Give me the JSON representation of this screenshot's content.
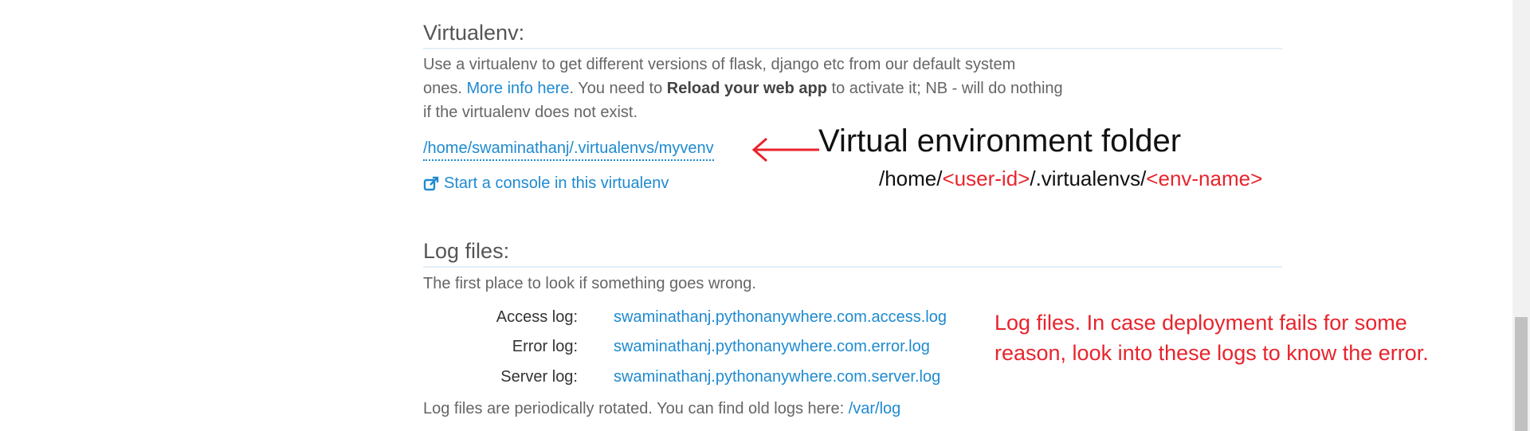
{
  "virtualenv": {
    "title": "Virtualenv:",
    "desc_part1": "Use a virtualenv to get different versions of flask, django etc from our default system",
    "desc_part2": "ones. ",
    "more_info": "More info here",
    "desc_part3": ". You need to ",
    "reload_text": "Reload your web app",
    "desc_part4": " to activate it; NB - will do nothing",
    "desc_part5": "if the virtualenv does not exist.",
    "path": "/home/swaminathanj/.virtualenvs/myvenv",
    "console_label": "Start a console in this virtualenv"
  },
  "annotations": {
    "venv_title": "Virtual environment folder",
    "path_prefix": "/home/",
    "path_user": "<user-id>",
    "path_middle": "/.virtualenvs/",
    "path_env": "<env-name>",
    "log_note_line1": "Log files. In case deployment fails for some",
    "log_note_line2": "reason, look into these logs to know the error."
  },
  "logs": {
    "title": "Log files:",
    "desc": "The first place to look if something goes wrong.",
    "entries": [
      {
        "label": "Access log:",
        "file": "swaminathanj.pythonanywhere.com.access.log"
      },
      {
        "label": "Error log:",
        "file": "swaminathanj.pythonanywhere.com.error.log"
      },
      {
        "label": "Server log:",
        "file": "swaminathanj.pythonanywhere.com.server.log"
      }
    ],
    "rotated_text": "Log files are periodically rotated. You can find old logs here: ",
    "old_logs_link": "/var/log"
  },
  "colors": {
    "link": "#1e8ad0",
    "annotation_red": "#e8242d"
  }
}
